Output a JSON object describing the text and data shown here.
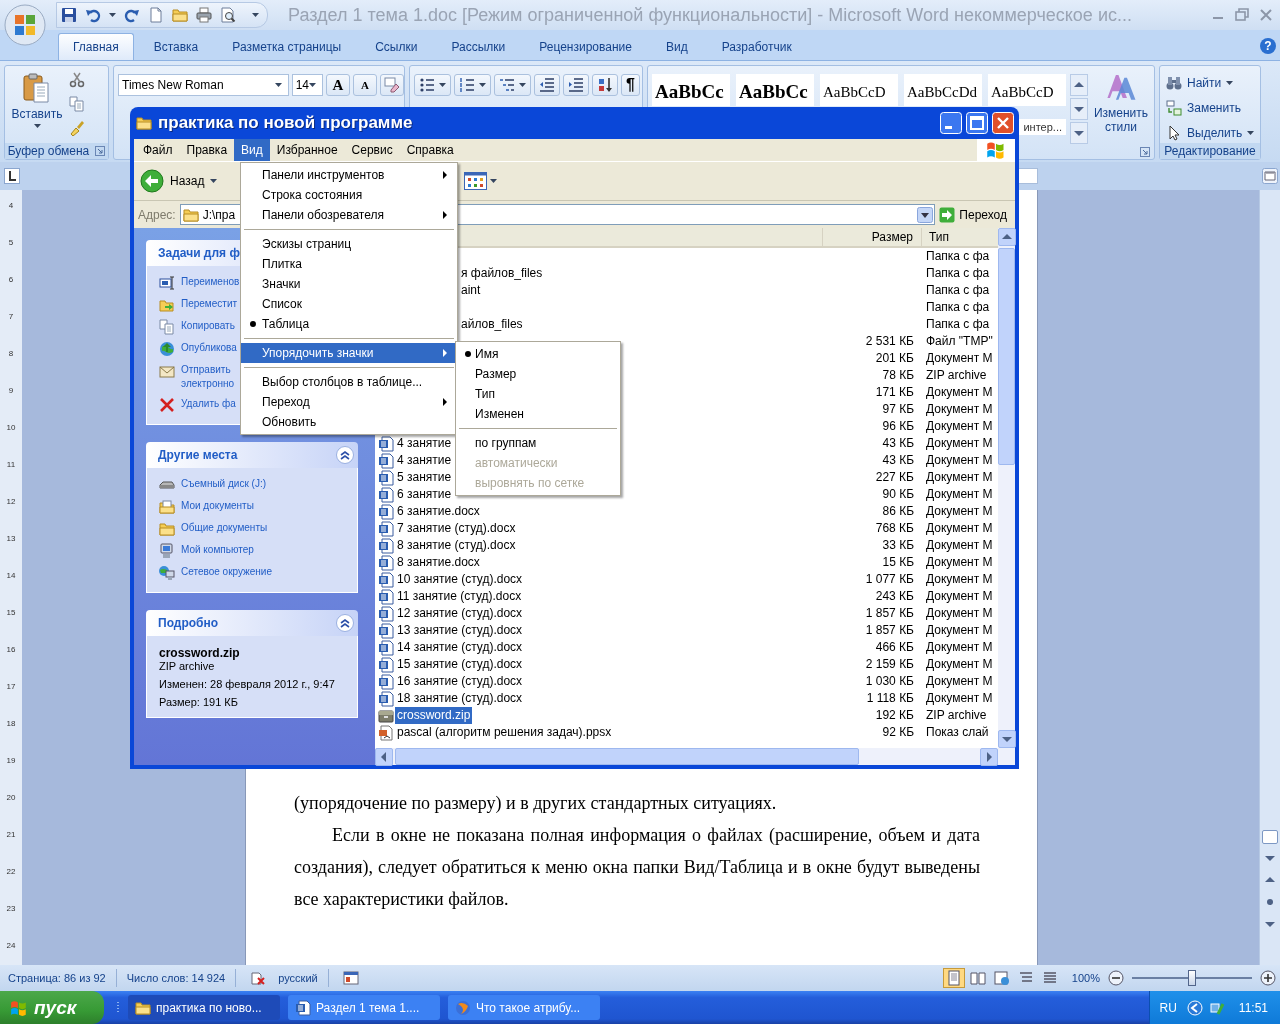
{
  "word": {
    "title": "Раздел 1 тема 1.doc [Режим ограниченной функциональности]  -  Microsoft Word некоммерческое ис...",
    "tabs": [
      {
        "label": "Главная",
        "selected": true
      },
      {
        "label": "Вставка",
        "selected": false
      },
      {
        "label": "Разметка страницы",
        "selected": false
      },
      {
        "label": "Ссылки",
        "selected": false
      },
      {
        "label": "Рассылки",
        "selected": false
      },
      {
        "label": "Рецензирование",
        "selected": false
      },
      {
        "label": "Вид",
        "selected": false
      },
      {
        "label": "Разработчик",
        "selected": false
      }
    ],
    "help": "?",
    "clipboard": {
      "paste": "Вставить",
      "label": "Буфер обмена"
    },
    "font": {
      "combo_values": [
        "Times New Roman",
        "14"
      ],
      "grow": "A",
      "shrink": "A"
    },
    "paragraph": {
      "marks": "¶"
    },
    "styles": [
      {
        "preview": "AaBbCc",
        "kind": "strong"
      },
      {
        "preview": "AaBbCc",
        "kind": "strong"
      },
      {
        "preview": "AaBbCcD",
        "kind": "plain"
      },
      {
        "preview": "AaBbCcDd",
        "kind": "plain"
      },
      {
        "preview": "AaBbCcD",
        "kind": "plain",
        "caption": "интер..."
      }
    ],
    "change_styles": "Изменить стили",
    "editing": {
      "items": [
        {
          "label": "Найти",
          "kind": "find",
          "dropdown": true
        },
        {
          "label": "Заменить",
          "kind": "replace",
          "dropdown": false
        },
        {
          "label": "Выделить",
          "kind": "select",
          "dropdown": true
        }
      ],
      "label": "Редактирование"
    },
    "ruler_marks": [
      "4",
      "5",
      "6",
      "7",
      "8",
      "9",
      "10",
      "11",
      "12",
      "13",
      "14",
      "15",
      "16",
      "17",
      "18",
      "19",
      "20",
      "21",
      "22",
      "23",
      "24"
    ],
    "document": [
      {
        "kind": "continued",
        "text": "(упорядочение по размеру) и в других стандартных ситуациях."
      },
      {
        "kind": "indented",
        "text": "Если в окне не показана полная информация о файлах (расширение, объем и дата создания), следует обратиться к меню окна папки Вид/Таблица и в окне будут выведены все характеристики файлов."
      }
    ],
    "status_bar": {
      "page": "Страница: 86 из 92",
      "words": "Число слов: 14 924",
      "language": "русский",
      "views": [
        {
          "selected": true
        },
        {
          "selected": false
        },
        {
          "selected": false
        },
        {
          "selected": false
        },
        {
          "selected": false
        }
      ],
      "zoom": {
        "reading": "100%",
        "level": 0.5
      }
    }
  },
  "explorer": {
    "title": "практика по новой программе",
    "menu": [
      {
        "label": "Файл",
        "selected": false
      },
      {
        "label": "Правка",
        "selected": false
      },
      {
        "label": "Вид",
        "selected": true
      },
      {
        "label": "Избранное",
        "selected": false
      },
      {
        "label": "Сервис",
        "selected": false
      },
      {
        "label": "Справка",
        "selected": false
      }
    ],
    "back": "Назад",
    "address": {
      "label": "Адрес:",
      "value": "J:\\пра",
      "go": "Переход"
    },
    "panels": [
      {
        "title": "Задачи для ф",
        "kind": "links",
        "items": [
          {
            "text": "Переименов",
            "kind": "rename"
          },
          {
            "text": "Переместит",
            "kind": "move"
          },
          {
            "text": "Копировать",
            "kind": "copy"
          },
          {
            "text": "Опубликова",
            "kind": "publish"
          },
          {
            "text": "Отправить\nэлектронно",
            "kind": "mail"
          },
          {
            "text": "Удалить фа",
            "kind": "delete"
          }
        ]
      },
      {
        "title": "Другие места",
        "kind": "links",
        "items": [
          {
            "text": "Съемный диск (J:)",
            "kind": "drive"
          },
          {
            "text": "Мои документы",
            "kind": "mydocs"
          },
          {
            "text": "Общие документы",
            "kind": "folder"
          },
          {
            "text": "Мой компьютер",
            "kind": "computer"
          },
          {
            "text": "Сетевое окружение",
            "kind": "network"
          }
        ]
      },
      {
        "title": "Подробно",
        "kind": "details",
        "name": "crossword.zip",
        "type": "ZIP archive",
        "lines": [
          "Изменен: 28 февраля 2012 г., 9:47",
          "Размер: 191 КБ"
        ]
      }
    ],
    "columns": [
      "Размер",
      "Тип"
    ],
    "files": [
      {
        "kind": "covered",
        "type": "Папка с фа",
        "selected": false
      },
      {
        "kind": "covered",
        "name": "я файлов_files",
        "type": "Папка с фа",
        "selected": false
      },
      {
        "kind": "covered",
        "name": "aint",
        "type": "Папка с фа",
        "selected": false
      },
      {
        "kind": "covered",
        "type": "Папка с фа",
        "selected": false
      },
      {
        "kind": "covered",
        "name": "айлов_files",
        "type": "Папка с фа",
        "selected": false
      },
      {
        "kind": "covered",
        "size": "2 531 КБ",
        "type": "Файл \"TMP\"",
        "selected": false
      },
      {
        "kind": "covered",
        "size": "201 КБ",
        "type": "Документ M",
        "selected": false
      },
      {
        "kind": "covered",
        "size": "78 КБ",
        "type": "ZIP archive",
        "selected": false
      },
      {
        "kind": "covered",
        "size": "171 КБ",
        "type": "Документ M",
        "selected": false
      },
      {
        "kind": "covered",
        "size": "97 КБ",
        "type": "Документ M",
        "selected": false
      },
      {
        "kind": "covered",
        "size": "96 КБ",
        "type": "Документ M",
        "selected": false
      },
      {
        "kind": "word",
        "name": "4 занятие",
        "size": "43 КБ",
        "type": "Документ M",
        "selected": false
      },
      {
        "kind": "word",
        "name": "4 занятие",
        "size": "43 КБ",
        "type": "Документ M",
        "selected": false
      },
      {
        "kind": "word",
        "name": "5 занятие",
        "size": "227 КБ",
        "type": "Документ M",
        "selected": false
      },
      {
        "kind": "word",
        "name": "6 занятие",
        "size": "90 КБ",
        "type": "Документ M",
        "selected": false
      },
      {
        "kind": "word",
        "name": "6 занятие.docx",
        "size": "86 КБ",
        "type": "Документ M",
        "selected": false
      },
      {
        "kind": "word",
        "name": "7 занятие (студ).docx",
        "size": "768 КБ",
        "type": "Документ M",
        "selected": false
      },
      {
        "kind": "word",
        "name": "8 занятие (студ).docx",
        "size": "33 КБ",
        "type": "Документ M",
        "selected": false
      },
      {
        "kind": "word",
        "name": "8 занятие.docx",
        "size": "15 КБ",
        "type": "Документ M",
        "selected": false
      },
      {
        "kind": "word",
        "name": "10 занятие (студ).docx",
        "size": "1 077 КБ",
        "type": "Документ M",
        "selected": false
      },
      {
        "kind": "word",
        "name": "11 занятие (студ).docx",
        "size": "243 КБ",
        "type": "Документ M",
        "selected": false
      },
      {
        "kind": "word",
        "name": "12 занятие (студ).docx",
        "size": "1 857 КБ",
        "type": "Документ M",
        "selected": false
      },
      {
        "kind": "word",
        "name": "13 занятие (студ).docx",
        "size": "1 857 КБ",
        "type": "Документ M",
        "selected": false
      },
      {
        "kind": "word",
        "name": "14 занятие (студ).docx",
        "size": "466 КБ",
        "type": "Документ M",
        "selected": false
      },
      {
        "kind": "word",
        "name": "15 занятие (студ).docx",
        "size": "2 159 КБ",
        "type": "Документ M",
        "selected": false
      },
      {
        "kind": "word",
        "name": "16 занятие (студ).docx",
        "size": "1 030 КБ",
        "type": "Документ M",
        "selected": false
      },
      {
        "kind": "word",
        "name": "18 занятие (студ).docx",
        "size": "1 118 КБ",
        "type": "Документ M",
        "selected": false
      },
      {
        "kind": "zip",
        "name": "crossword.zip",
        "size": "192 КБ",
        "type": "ZIP archive",
        "selected": true
      },
      {
        "kind": "slides",
        "name": "pascal (алгоритм решения задач).ppsx",
        "size": "92 КБ",
        "type": "Показ слай",
        "selected": false
      }
    ],
    "view_menu": [
      {
        "kind": "item",
        "label": "Панели инструментов",
        "checked": false,
        "submenu": true,
        "highlighted": false,
        "disabled": false
      },
      {
        "kind": "item",
        "label": "Строка состояния",
        "checked": false,
        "submenu": false,
        "highlighted": false,
        "disabled": false
      },
      {
        "kind": "item",
        "label": "Панели обозревателя",
        "checked": false,
        "submenu": true,
        "highlighted": false,
        "disabled": false
      },
      {
        "kind": "separator"
      },
      {
        "kind": "item",
        "label": "Эскизы страниц",
        "checked": false,
        "submenu": false,
        "highlighted": false,
        "disabled": false
      },
      {
        "kind": "item",
        "label": "Плитка",
        "checked": false,
        "submenu": false,
        "highlighted": false,
        "disabled": false
      },
      {
        "kind": "item",
        "label": "Значки",
        "checked": false,
        "submenu": false,
        "highlighted": false,
        "disabled": false
      },
      {
        "kind": "item",
        "label": "Список",
        "checked": false,
        "submenu": false,
        "highlighted": false,
        "disabled": false
      },
      {
        "kind": "item",
        "label": "Таблица",
        "checked": true,
        "submenu": false,
        "highlighted": false,
        "disabled": false
      },
      {
        "kind": "separator"
      },
      {
        "kind": "item",
        "label": "Упорядочить значки",
        "checked": false,
        "submenu": true,
        "highlighted": true,
        "disabled": false
      },
      {
        "kind": "separator"
      },
      {
        "kind": "item",
        "label": "Выбор столбцов в таблице...",
        "checked": false,
        "submenu": false,
        "highlighted": false,
        "disabled": false
      },
      {
        "kind": "item",
        "label": "Переход",
        "checked": false,
        "submenu": true,
        "highlighted": false,
        "disabled": false
      },
      {
        "kind": "item",
        "label": "Обновить",
        "checked": false,
        "submenu": false,
        "highlighted": false,
        "disabled": false
      }
    ],
    "arrange_menu": [
      {
        "kind": "item",
        "label": "Имя",
        "checked": true,
        "submenu": false,
        "highlighted": false,
        "disabled": false
      },
      {
        "kind": "item",
        "label": "Размер",
        "checked": false,
        "submenu": false,
        "highlighted": false,
        "disabled": false
      },
      {
        "kind": "item",
        "label": "Тип",
        "checked": false,
        "submenu": false,
        "highlighted": false,
        "disabled": false
      },
      {
        "kind": "item",
        "label": "Изменен",
        "checked": false,
        "submenu": false,
        "highlighted": false,
        "disabled": false
      },
      {
        "kind": "separator"
      },
      {
        "kind": "item",
        "label": "по группам",
        "checked": false,
        "submenu": false,
        "highlighted": false,
        "disabled": false
      },
      {
        "kind": "item",
        "label": "автоматически",
        "checked": false,
        "submenu": false,
        "highlighted": false,
        "disabled": true
      },
      {
        "kind": "item",
        "label": "выровнять по сетке",
        "checked": false,
        "submenu": false,
        "highlighted": false,
        "disabled": true
      }
    ]
  },
  "taskbar": {
    "start": "пуск",
    "tasks": [
      {
        "label": "практика по ново...",
        "kind": "folder",
        "selected": true
      },
      {
        "label": "Раздел 1 тема 1....",
        "kind": "word",
        "selected": false
      },
      {
        "label": "Что такое атрибу...",
        "kind": "browser",
        "selected": false
      }
    ],
    "language": "RU",
    "clock": "11:51"
  }
}
